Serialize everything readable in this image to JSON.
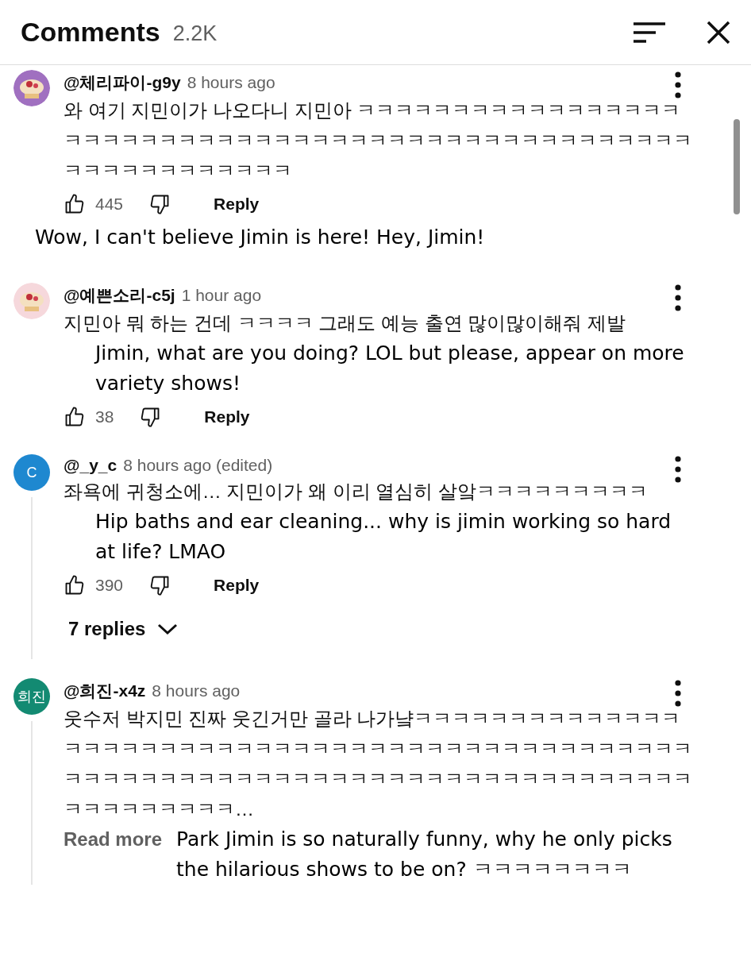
{
  "header": {
    "title": "Comments",
    "count": "2.2K"
  },
  "comments": [
    {
      "author": "@체리파이-g9y",
      "time": "8 hours ago",
      "body": "와 여기 지민이가 나오다니 지민아 ㅋㅋㅋㅋㅋㅋㅋㅋㅋㅋㅋㅋㅋㅋㅋㅋㅋㅋㅋㅋㅋㅋㅋㅋㅋㅋㅋㅋㅋㅋㅋㅋㅋㅋㅋㅋㅋㅋㅋㅋㅋㅋㅋㅋㅋㅋㅋㅋㅋㅋㅋㅋㅋㅋㅋㅋㅋㅋㅋㅋㅋㅋ",
      "likes": "445",
      "reply": "Reply",
      "translation_below": "Wow, I can't believe Jimin is here! Hey, Jimin!"
    },
    {
      "author": "@예쁜소리-c5j",
      "time": "1 hour ago",
      "body": "지민아 뭐 하는 건데 ㅋㅋㅋㅋ 그래도 예능 출연 많이많이해줘 제발",
      "translation": "Jimin, what are you doing? LOL but please, appear on more variety shows!",
      "likes": "38",
      "reply": "Reply"
    },
    {
      "avatar": {
        "kind": "letter",
        "text": "C",
        "color": "#1e88d0"
      },
      "author": "@_y_c",
      "time": "8 hours ago (edited)",
      "body": "좌욕에 귀청소에… 지민이가 왜 이리 열심히 살앜ㅋㅋㅋㅋㅋㅋㅋㅋㅋ",
      "translation": "Hip baths and ear cleaning... why is jimin working so hard at life? LMAO",
      "likes": "390",
      "reply": "Reply",
      "replies": "7 replies"
    },
    {
      "avatar": {
        "kind": "letter",
        "text": "희진",
        "color": "#138a72"
      },
      "author": "@희진-x4z",
      "time": "8 hours ago",
      "body": "웃수저 박지민 진짜 웃긴거만 골라 나가냨ㅋㅋㅋㅋㅋㅋㅋㅋㅋㅋㅋㅋㅋㅋㅋㅋㅋㅋㅋㅋㅋㅋㅋㅋㅋㅋㅋㅋㅋㅋㅋㅋㅋㅋㅋㅋㅋㅋㅋㅋㅋㅋㅋㅋㅋㅋㅋㅋㅋㅋㅋㅋㅋㅋㅋㅋㅋㅋㅋㅋㅋㅋㅋㅋㅋㅋㅋㅋㅋㅋㅋㅋㅋㅋㅋㅋㅋㅋㅋㅋㅋㅋㅋㅋㅋㅋㅋㅋㅋ…",
      "read_more": "Read more",
      "translation": "Park Jimin is so naturally funny, why he only picks the hilarious shows to be on? ㅋㅋㅋㅋㅋㅋㅋㅋ"
    }
  ]
}
